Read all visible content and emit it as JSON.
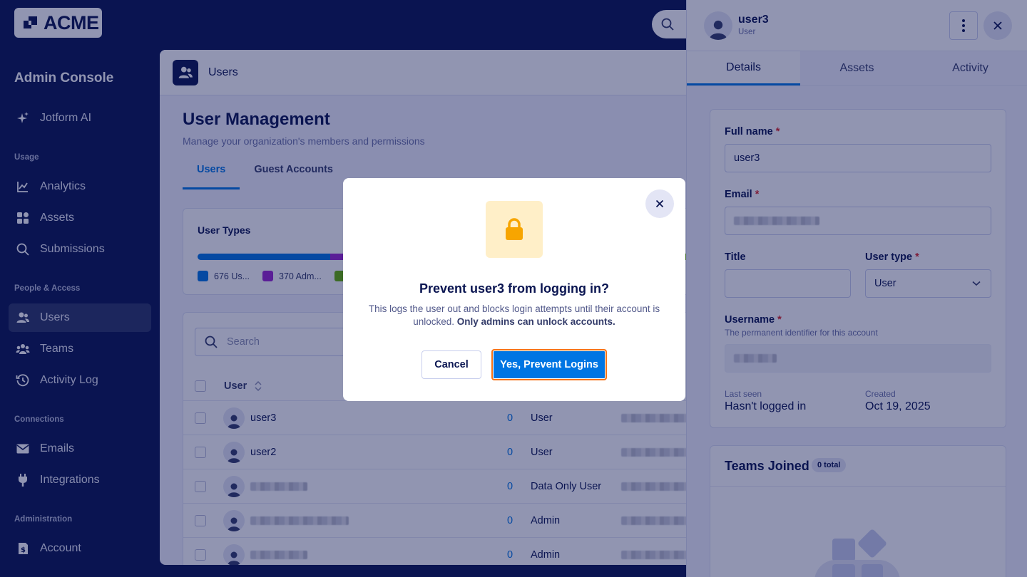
{
  "brand": {
    "logo_text": "ACME"
  },
  "sidebar": {
    "title": "Admin Console",
    "ai_item": "Jotform AI",
    "sections": {
      "usage": "Usage",
      "people": "People & Access",
      "connections": "Connections",
      "administration": "Administration"
    },
    "items": {
      "analytics": "Analytics",
      "assets": "Assets",
      "submissions": "Submissions",
      "users": "Users",
      "teams": "Teams",
      "activity_log": "Activity Log",
      "emails": "Emails",
      "integrations": "Integrations",
      "account": "Account"
    }
  },
  "main": {
    "header_title": "Users",
    "page_title": "User Management",
    "page_subtitle": "Manage your organization's members and permissions",
    "tabs": [
      "Users",
      "Guest Accounts"
    ],
    "user_types": {
      "title": "User Types",
      "legend": [
        "676 Us...",
        "370 Adm..."
      ],
      "colors": [
        "#0075e3",
        "#9c27d0",
        "#64b200"
      ],
      "shares": [
        0.258,
        0.114,
        0.628
      ]
    },
    "search_placeholder": "Search",
    "table": {
      "col_user": "User",
      "rows": [
        {
          "name": "user3",
          "count": "0",
          "role": "User"
        },
        {
          "name": "user2",
          "count": "0",
          "role": "User"
        },
        {
          "name": "",
          "count": "0",
          "role": "Data Only User"
        },
        {
          "name": "",
          "count": "0",
          "role": "Admin"
        },
        {
          "name": "",
          "count": "0",
          "role": "Admin"
        }
      ]
    }
  },
  "drawer": {
    "user_name": "user3",
    "user_role": "User",
    "tabs": [
      "Details",
      "Assets",
      "Activity"
    ],
    "fields": {
      "full_name_label": "Full name",
      "full_name_value": "user3",
      "email_label": "Email",
      "title_label": "Title",
      "user_type_label": "User type",
      "user_type_value": "User",
      "username_label": "Username",
      "username_help": "The permanent identifier for this account",
      "last_seen_label": "Last seen",
      "last_seen_value": "Hasn't logged in",
      "created_label": "Created",
      "created_value": "Oct 19, 2025",
      "required_mark": "*"
    },
    "teams": {
      "title": "Teams Joined",
      "badge": "0 total"
    }
  },
  "modal": {
    "title": "Prevent user3 from logging in?",
    "body_prefix": "This logs the user out and blocks login attempts until their account is unlocked. ",
    "body_bold": "Only admins can unlock accounts.",
    "cancel_label": "Cancel",
    "confirm_label": "Yes, Prevent Logins"
  },
  "colors": {
    "navy": "#0a1551",
    "accent": "#0075e3",
    "lock": "#f7a500",
    "focus": "#f97316"
  }
}
